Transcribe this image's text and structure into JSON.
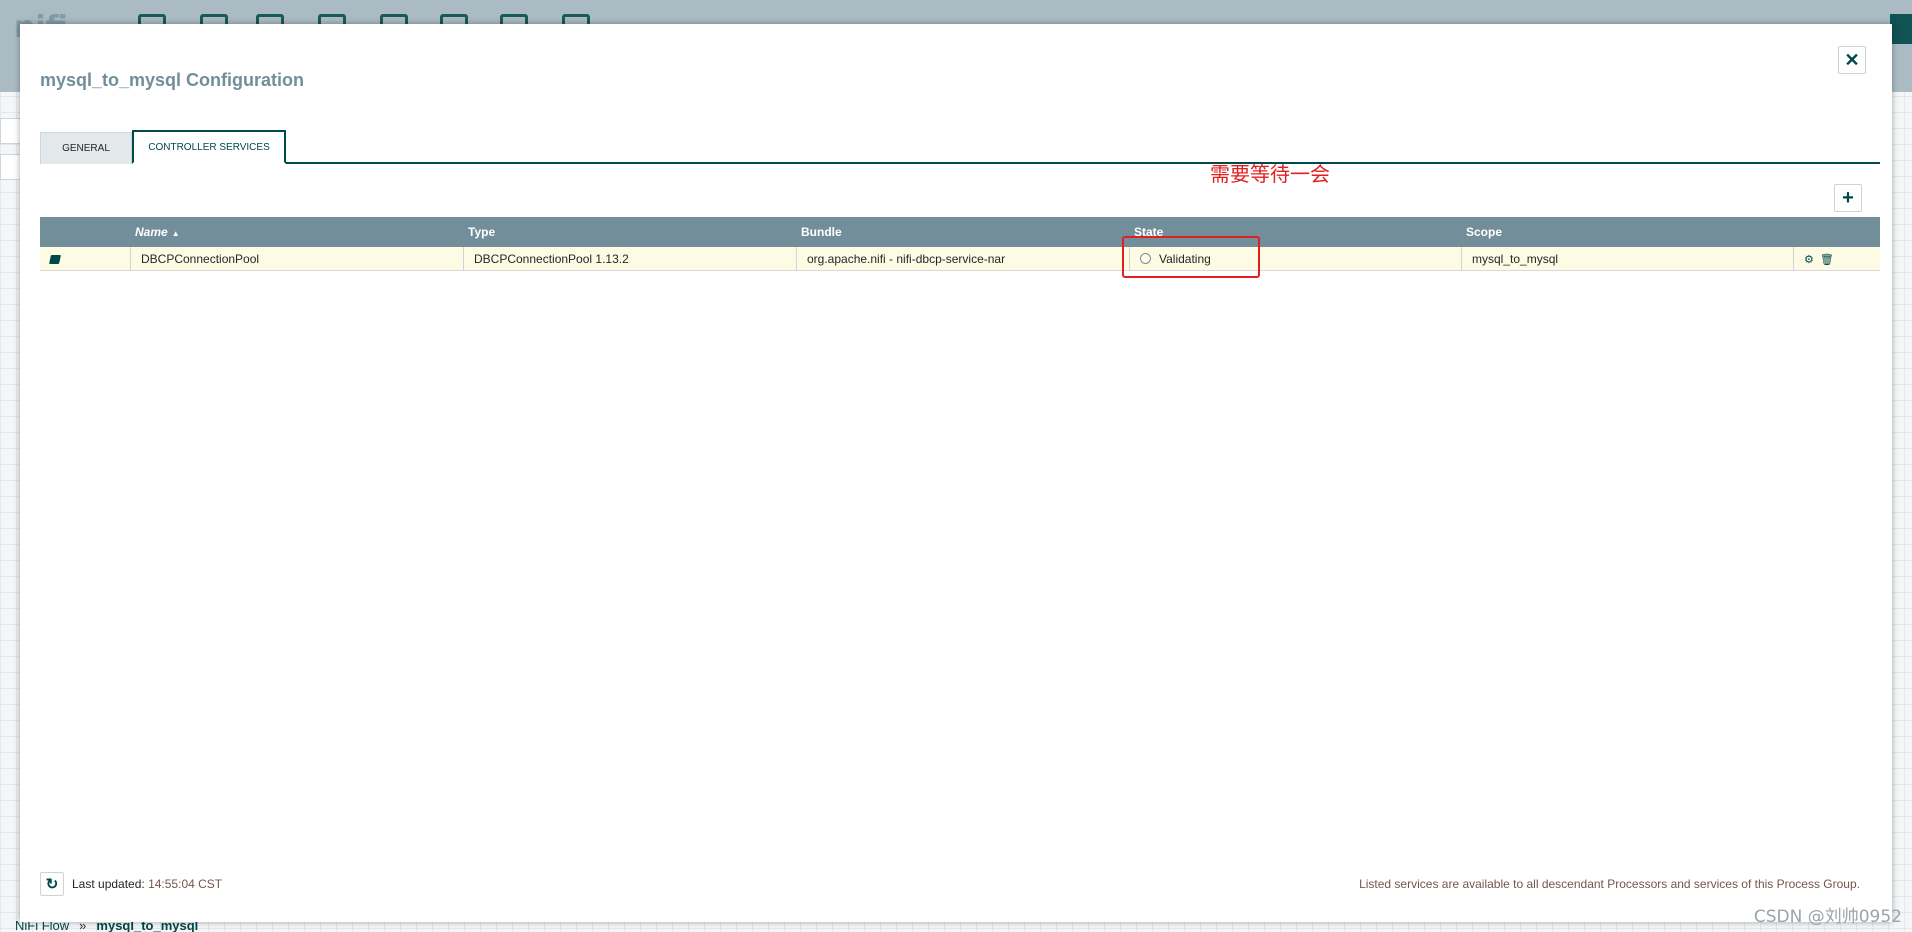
{
  "app": {
    "logo_text": "nifi",
    "breadcrumb": {
      "root": "NiFi Flow",
      "separator": "»",
      "current": "mysql_to_mysql"
    }
  },
  "dialog": {
    "title": "mysql_to_mysql Configuration",
    "close_glyph": "✕",
    "tabs": [
      {
        "label": "GENERAL",
        "active": false
      },
      {
        "label": "CONTROLLER SERVICES",
        "active": true
      }
    ],
    "add_glyph": "+",
    "annotation": "需要等待一会",
    "table": {
      "columns": [
        "",
        "Name",
        "Type",
        "Bundle",
        "State",
        "Scope",
        ""
      ],
      "sort_column": "Name",
      "sort_glyph": "▲",
      "rows": [
        {
          "icon": "docs-icon",
          "name": "DBCPConnectionPool",
          "type": "DBCPConnectionPool 1.13.2",
          "bundle": "org.apache.nifi - nifi-dbcp-service-nar",
          "state": "Validating",
          "scope": "mysql_to_mysql",
          "actions": [
            {
              "icon": "gear-icon",
              "glyph": "⚙"
            },
            {
              "icon": "trash-icon",
              "glyph": "🗑"
            }
          ]
        }
      ]
    },
    "footer": {
      "refresh_glyph": "↻",
      "last_updated_label": "Last updated:",
      "last_updated_time": "14:55:04 CST",
      "note": "Listed services are available to all descendant Processors and services of this Process Group."
    }
  },
  "watermark": "CSDN @刘帅0952",
  "colors": {
    "header_bg": "#728e9b",
    "accent": "#004849",
    "row_bg": "#fdfbe4",
    "annotation": "#e02020",
    "timestamp": "#775351"
  }
}
